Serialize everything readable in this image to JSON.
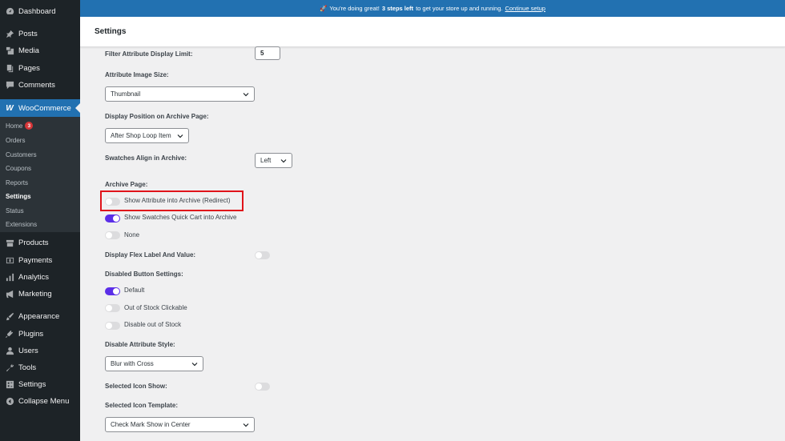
{
  "sidebar": {
    "items": [
      {
        "label": "Dashboard",
        "icon": "dashboard-icon"
      },
      {
        "label": "Posts",
        "icon": "pin-icon"
      },
      {
        "label": "Media",
        "icon": "media-icon"
      },
      {
        "label": "Pages",
        "icon": "pages-icon"
      },
      {
        "label": "Comments",
        "icon": "comment-icon"
      },
      {
        "label": "WooCommerce",
        "icon": "woo-icon"
      },
      {
        "label": "Products",
        "icon": "products-icon"
      },
      {
        "label": "Payments",
        "icon": "payments-icon"
      },
      {
        "label": "Analytics",
        "icon": "analytics-icon"
      },
      {
        "label": "Marketing",
        "icon": "megaphone-icon"
      },
      {
        "label": "Appearance",
        "icon": "brush-icon"
      },
      {
        "label": "Plugins",
        "icon": "plugin-icon"
      },
      {
        "label": "Users",
        "icon": "user-icon"
      },
      {
        "label": "Tools",
        "icon": "wrench-icon"
      },
      {
        "label": "Settings",
        "icon": "settings-icon"
      },
      {
        "label": "Collapse Menu",
        "icon": "collapse-icon"
      }
    ],
    "woo_icon_text": "W",
    "submenu": [
      {
        "label": "Home",
        "badge": "3"
      },
      {
        "label": "Orders"
      },
      {
        "label": "Customers"
      },
      {
        "label": "Coupons"
      },
      {
        "label": "Reports"
      },
      {
        "label": "Settings"
      },
      {
        "label": "Status"
      },
      {
        "label": "Extensions"
      }
    ]
  },
  "notice": {
    "emoji": "🚀",
    "prefix": "You're doing great!",
    "bold": "3 steps left",
    "middle": "to get your store up and running.",
    "link": "Continue setup"
  },
  "header": {
    "title": "Settings"
  },
  "form": {
    "filter_limit_label": "Filter Attribute Display Limit:",
    "filter_limit_value": "5",
    "image_size_label": "Attribute Image Size:",
    "image_size_value": "Thumbnail",
    "display_position_label": "Display Position on Archive Page:",
    "display_position_value": "After Shop Loop Item",
    "swatches_align_label": "Swatches Align in Archive:",
    "swatches_align_value": "Left",
    "archive_page_label": "Archive Page:",
    "archive_options": [
      {
        "label": "Show Attribute into Archive (Redirect)",
        "on": false
      },
      {
        "label": "Show Swatches Quick Cart into Archive",
        "on": true
      },
      {
        "label": "None",
        "on": false
      }
    ],
    "flex_label": "Display Flex Label And Value:",
    "disabled_button_label": "Disabled Button Settings:",
    "disabled_options": [
      {
        "label": "Default",
        "on": true
      },
      {
        "label": "Out of Stock Clickable",
        "on": false
      },
      {
        "label": "Disable out of Stock",
        "on": false
      }
    ],
    "disable_style_label": "Disable Attribute Style:",
    "disable_style_value": "Blur with Cross",
    "selected_icon_show_label": "Selected Icon Show:",
    "selected_icon_template_label": "Selected Icon Template:",
    "selected_icon_template_value": "Check Mark Show in Center"
  },
  "colors": {
    "sidebar": "#1d2327",
    "accent": "#2271b1",
    "toggle_on": "#5b2ee8",
    "highlight": "#e0131a"
  }
}
